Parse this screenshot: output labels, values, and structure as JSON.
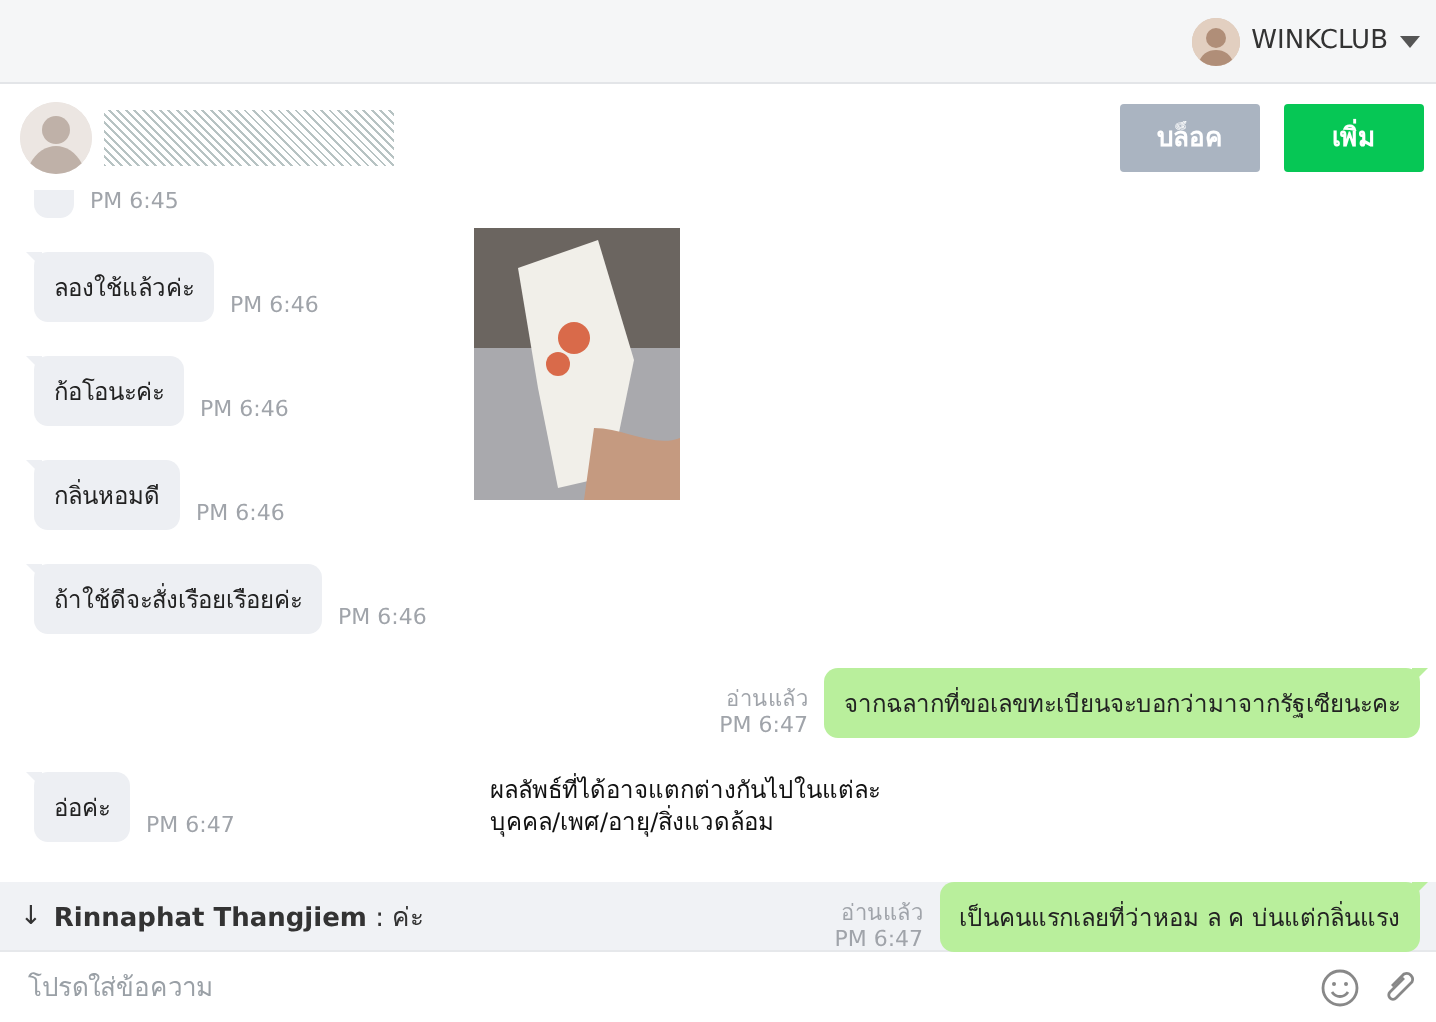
{
  "account": {
    "name": "WINKCLUB"
  },
  "contact": {
    "buttons": [
      {
        "kind": "block",
        "label": "บล็อค"
      },
      {
        "kind": "add",
        "label": "เพิ่ม"
      }
    ]
  },
  "messages": [
    {
      "kind": "received",
      "time": "PM 6:45"
    },
    {
      "kind": "received",
      "text": "ลองใช้แล้วค่ะ",
      "time": "PM 6:46"
    },
    {
      "kind": "received",
      "text": "ก้อโอนะค่ะ",
      "time": "PM 6:46"
    },
    {
      "kind": "received",
      "text": "กลิ่นหอมดี",
      "time": "PM 6:46"
    },
    {
      "kind": "received",
      "text": "ถ้าใช้ดีจะสั่งเรือยเรือยค่ะ",
      "time": "PM 6:46"
    },
    {
      "kind": "sent",
      "text": "จากฉลากที่ขอเลขทะเบียนจะบอกว่ามาจากรัฐเซียนะคะ",
      "read": "อ่านแล้ว",
      "time": "PM 6:47"
    },
    {
      "kind": "received",
      "text": "อ่อค่ะ",
      "time": "PM 6:47"
    },
    {
      "kind": "sent",
      "text": "เป็นคนแรกเลยที่ว่าหอม ล ค บ่นแต่กลิ่นแรง",
      "read": "อ่านแล้ว",
      "time": "PM 6:47"
    }
  ],
  "caption": "ผลลัพธ์ที่ได้อาจแตกต่างกันไปในแต่ละบุคคล/เพศ/อายุ/สิ่งแวดล้อม",
  "notice": {
    "sender": "Rinnaphat Thangjiem",
    "separator": " : ",
    "text": "ค่ะ",
    "arrow": "↓"
  },
  "composer": {
    "placeholder": "โปรดใส่ข้อความ"
  }
}
